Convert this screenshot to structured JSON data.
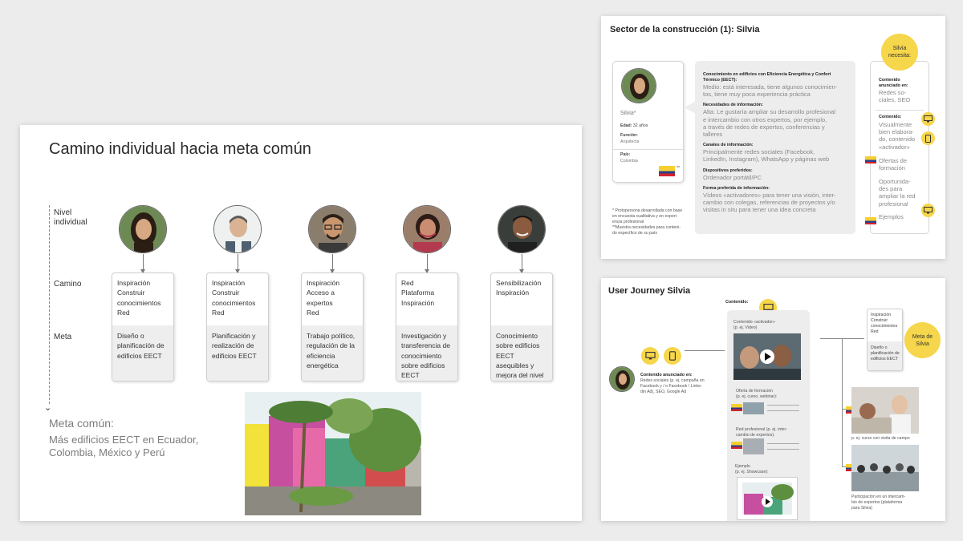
{
  "main": {
    "title": "Camino individual hacia meta común",
    "row_labels": {
      "nivel": [
        "Nivel",
        "individual"
      ],
      "camino": "Camino",
      "meta": "Meta"
    },
    "cards": [
      {
        "camino": [
          "Inspiración",
          "Construir",
          "conocimientos",
          "Red"
        ],
        "meta": "Diseño o planificación de edificios EECT"
      },
      {
        "camino": [
          "Inspiración",
          "Construir",
          "conocimientos",
          "Red"
        ],
        "meta": "Planificación y realización de edificios EECT"
      },
      {
        "camino": [
          "Inspiración",
          "Acceso a",
          "expertos",
          "Red"
        ],
        "meta": "Trabajo político, regulación de la eficiencia energética"
      },
      {
        "camino": [
          "Red",
          "Plataforma",
          "Inspiración"
        ],
        "meta": "Investigación y transferencia de conocimiento sobre edificios EECT"
      },
      {
        "camino": [
          "Sensibilización",
          "Inspiración"
        ],
        "meta": "Conocimiento sobre edificios EECT asequibles y mejora del nivel de vida"
      }
    ],
    "meta_comun_title": "Meta común:",
    "meta_comun_text": "Más edificios EECT en Ecuador, Colombia, México y Perú"
  },
  "top_right": {
    "title": "Sector de la construcción (1): Silvia",
    "profile": {
      "name": "Silvia*",
      "edad_label": "Edad:",
      "edad_value": "32 años",
      "funcion_label": "Función:",
      "funcion_value": "Arquitecta",
      "pais_label": "País:",
      "pais_value": "Colombia",
      "flag_note": "**"
    },
    "footnote": [
      "* Protopersona desarrollada con base",
      "en encuesta cualitativa y en experi-",
      "encia profesional",
      "**Muestra necesidades para conteni-",
      "do específico de su país"
    ],
    "details": [
      {
        "h": "Conocimiento en edificios con Eficiencia Energética y Confort Térmico (EECT):",
        "t": [
          "Medio: está interesada, tiene algunos conocimien-",
          "tos, tiene muy poca experiencia práctica"
        ]
      },
      {
        "h": "Necesidades de información:",
        "t": [
          "Alta: Le gustaría ampliar su desarrollo profesional",
          "e intercambio con otros expertos, por ejemplo,",
          "a través de redes de expertos, conferencias y",
          "talleres"
        ]
      },
      {
        "h": "Canales de información:",
        "t": [
          "Principalmente redes sociales (Facebook,",
          "LinkedIn, Instagram), WhatsApp y páginas web"
        ]
      },
      {
        "h": "Dispositivos preferidos:",
        "t": [
          "Ordenador portátil/PC"
        ]
      },
      {
        "h": "Forma preferida de información:",
        "t": [
          "Vídeos «activadores» para tener una visión, inter-",
          "cambio con colegas, referencias de proyectos y/o",
          "visitas in situ para tener una idea concreta"
        ]
      }
    ],
    "needs_badge": [
      "Silvia",
      "necesita:"
    ],
    "needs": {
      "anunciado_label": [
        "Contenido",
        "anunciado en:"
      ],
      "anunciado_text": [
        "Redes so-",
        "ciales, SEO"
      ],
      "contenido_label": "Contenido:",
      "contenido_text": [
        "Visualmente",
        "bien elabora-",
        "do, contenido",
        "«activador»"
      ],
      "formacion": [
        "Ofertas de",
        "formación"
      ],
      "oportunidades": [
        "Oportunida-",
        "des para",
        "ampliar la red",
        "profesional"
      ],
      "ejemplos": "Ejemplos"
    }
  },
  "bottom_right": {
    "title": "User Journey Silvia",
    "contenido_label": "Contenido:",
    "anunciado_title": "Contenido anunciado en:",
    "anunciado_text": [
      "Redes sociales (p. ej. campaña en",
      "Facebook y / o Facebook / Linke-",
      "din Ad), SEO, Google Ad"
    ],
    "activador": [
      "Contenido «activador»",
      "(p. ej. Video)"
    ],
    "formacion": [
      "Oferta de formación",
      "(p. ej. curso, webinar):"
    ],
    "red": [
      "Red profesional (p. ej. inter-",
      "cambio de expertos):"
    ],
    "ejemplo": [
      "Ejemplo",
      "(p. ej. Showcase):"
    ],
    "meta_card": [
      "Inspiración",
      "Construir",
      "conocimientos",
      "Red"
    ],
    "meta_card_bottom": [
      "Diseño o",
      "planificación de",
      "edificios EECT"
    ],
    "meta_badge": [
      "Meta de",
      "Silvia"
    ],
    "caption_campo": "p. ej. curso con visita de campo",
    "caption_intercambio": [
      "Participación en un intercam-",
      "bio de expertos (plataforma",
      "para Silvia)"
    ]
  },
  "colors": {
    "accent_yellow": "#f6d64a",
    "card_gray": "#eeeeee",
    "text_gray": "#7c7c7c"
  }
}
